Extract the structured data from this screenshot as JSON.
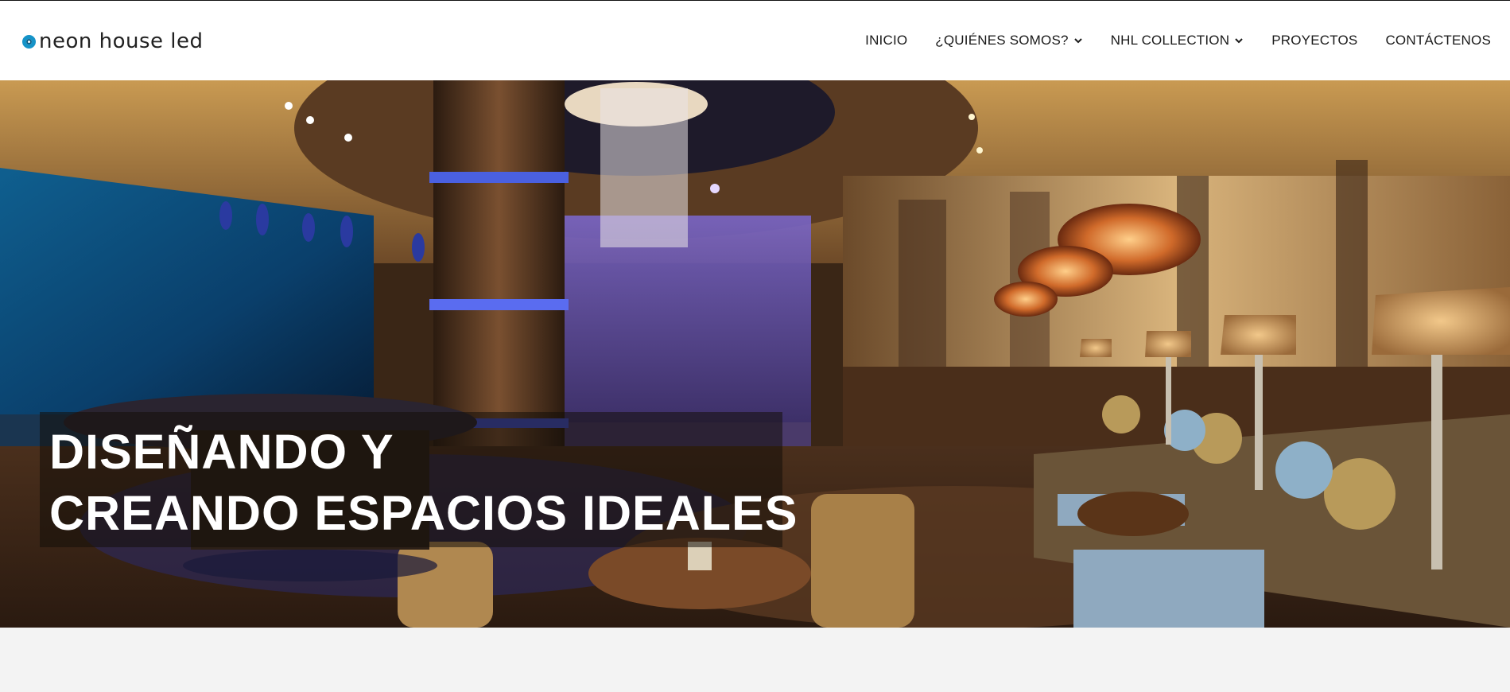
{
  "brand": {
    "name": "neon house led",
    "icon": "ring-logo-icon",
    "accent": "#1593c8"
  },
  "nav": {
    "items": [
      {
        "label": "INICIO",
        "has_dropdown": false
      },
      {
        "label": "¿QUIÉNES SOMOS?",
        "has_dropdown": true
      },
      {
        "label": "NHL COLLECTION",
        "has_dropdown": true
      },
      {
        "label": "PROYECTOS",
        "has_dropdown": false
      },
      {
        "label": "CONTÁCTENOS",
        "has_dropdown": false
      }
    ]
  },
  "hero": {
    "headline_line1": "DISEÑANDO Y",
    "headline_line2": "CREANDO ESPACIOS IDEALES",
    "image_subject": "lounge-interior-photo"
  },
  "colors": {
    "header_bg": "#ffffff",
    "page_bg": "#f3f3f3",
    "text": "#1a1a1a"
  }
}
